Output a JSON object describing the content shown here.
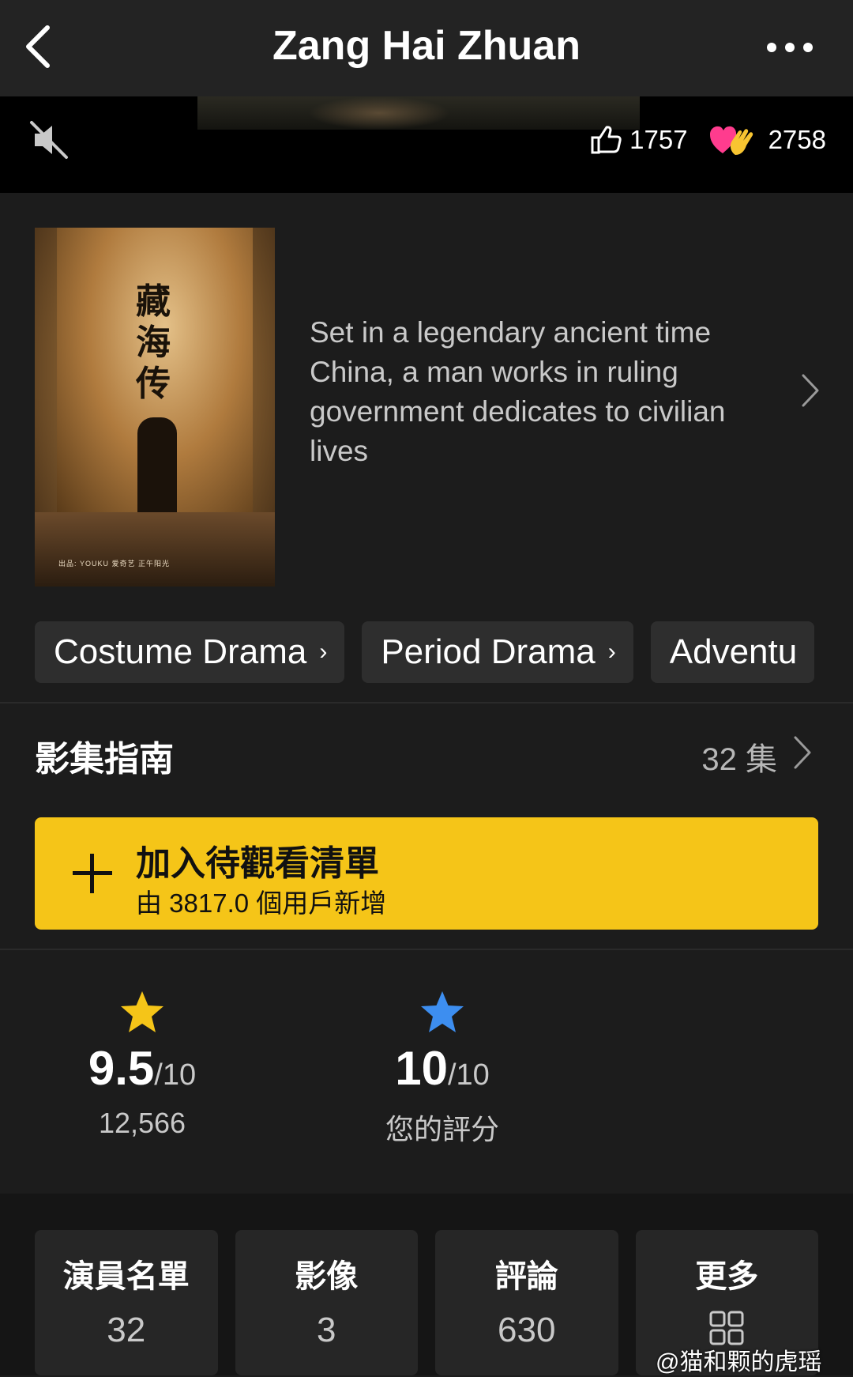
{
  "header": {
    "title": "Zang Hai Zhuan",
    "back_icon": "chevron-left-icon",
    "more_icon": "more-horizontal-icon"
  },
  "video": {
    "mute_icon": "mute-icon",
    "likes": "1757",
    "reactions": "2758"
  },
  "poster": {
    "title_chars": "藏海传",
    "credits": "出品: YOUKU 爱奇艺 正午阳光"
  },
  "synopsis": {
    "text": "Set in a legendary ancient time China, a man works in ruling government dedicates to civilian lives"
  },
  "genres": [
    {
      "label": "Costume Drama"
    },
    {
      "label": "Period Drama"
    },
    {
      "label": "Adventu"
    }
  ],
  "episodes": {
    "title": "影集指南",
    "count": "32 集"
  },
  "watchlist": {
    "label": "加入待觀看清單",
    "sub": "由 3817.0 個用戶新增"
  },
  "ratings": {
    "imdb": {
      "score": "9.5",
      "out_of": "/10",
      "votes": "12,566"
    },
    "user": {
      "score": "10",
      "out_of": "/10",
      "label": "您的評分"
    }
  },
  "tiles": [
    {
      "label": "演員名單",
      "value": "32"
    },
    {
      "label": "影像",
      "value": "3"
    },
    {
      "label": "評論",
      "value": "630"
    },
    {
      "label": "更多",
      "icon": "grid-icon"
    }
  ],
  "watermark": {
    "text": "@猫和颗的虎瑶"
  },
  "colors": {
    "accent": "#f5c518",
    "background": "#1c1c1c",
    "user_star": "#3d8ef0"
  }
}
